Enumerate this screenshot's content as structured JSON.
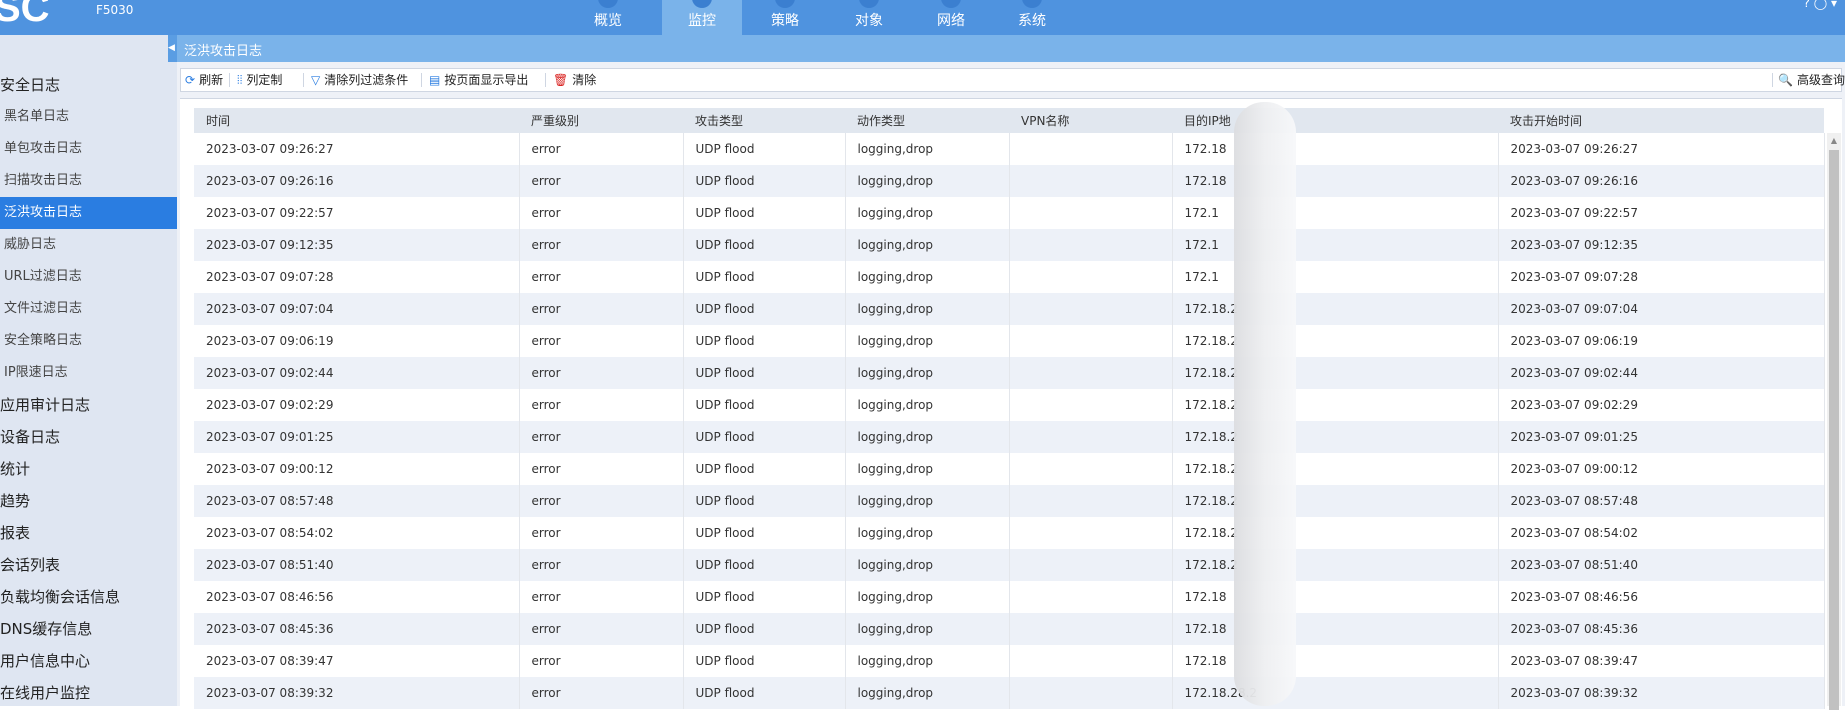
{
  "header": {
    "logo": "SC",
    "model": "F5030",
    "nav": [
      {
        "label": "概览"
      },
      {
        "label": "监控",
        "active": true
      },
      {
        "label": "策略"
      },
      {
        "label": "对象"
      },
      {
        "label": "网络"
      },
      {
        "label": "系统"
      }
    ]
  },
  "sidebar": {
    "items": [
      {
        "label": "安全日志",
        "level": 1
      },
      {
        "label": "黑名单日志",
        "level": 2
      },
      {
        "label": "单包攻击日志",
        "level": 2
      },
      {
        "label": "扫描攻击日志",
        "level": 2
      },
      {
        "label": "泛洪攻击日志",
        "level": 2,
        "selected": true
      },
      {
        "label": "威胁日志",
        "level": 2
      },
      {
        "label": "URL过滤日志",
        "level": 2
      },
      {
        "label": "文件过滤日志",
        "level": 2
      },
      {
        "label": "安全策略日志",
        "level": 2
      },
      {
        "label": "IP限速日志",
        "level": 2
      },
      {
        "label": "应用审计日志",
        "level": 1
      },
      {
        "label": "设备日志",
        "level": 1
      },
      {
        "label": "统计",
        "level": 1
      },
      {
        "label": "趋势",
        "level": 1
      },
      {
        "label": "报表",
        "level": 1
      },
      {
        "label": "会话列表",
        "level": 1
      },
      {
        "label": "负载均衡会话信息",
        "level": 1
      },
      {
        "label": "DNS缓存信息",
        "level": 1
      },
      {
        "label": "用户信息中心",
        "level": 1
      },
      {
        "label": "在线用户监控",
        "level": 1
      }
    ]
  },
  "breadcrumb": "泛洪攻击日志",
  "toolbar": {
    "refresh": "刷新",
    "columns": "列定制",
    "clear_filter": "清除列过滤条件",
    "export": "按页面显示导出",
    "clear": "清除",
    "advanced": "高级查询"
  },
  "table": {
    "headers": [
      "时间",
      "严重级别",
      "攻击类型",
      "动作类型",
      "VPN名称",
      "目的IP地",
      "攻击开始时间"
    ],
    "rows": [
      [
        "2023-03-07 09:26:27",
        "error",
        "UDP flood",
        "logging,drop",
        "",
        "172.18",
        "2023-03-07 09:26:27"
      ],
      [
        "2023-03-07 09:26:16",
        "error",
        "UDP flood",
        "logging,drop",
        "",
        "172.18",
        "2023-03-07 09:26:16"
      ],
      [
        "2023-03-07 09:22:57",
        "error",
        "UDP flood",
        "logging,drop",
        "",
        "172.1",
        "2023-03-07 09:22:57"
      ],
      [
        "2023-03-07 09:12:35",
        "error",
        "UDP flood",
        "logging,drop",
        "",
        "172.1",
        "2023-03-07 09:12:35"
      ],
      [
        "2023-03-07 09:07:28",
        "error",
        "UDP flood",
        "logging,drop",
        "",
        "172.1",
        "2023-03-07 09:07:28"
      ],
      [
        "2023-03-07 09:07:04",
        "error",
        "UDP flood",
        "logging,drop",
        "",
        "172.18.2",
        "2023-03-07 09:07:04"
      ],
      [
        "2023-03-07 09:06:19",
        "error",
        "UDP flood",
        "logging,drop",
        "",
        "172.18.2",
        "2023-03-07 09:06:19"
      ],
      [
        "2023-03-07 09:02:44",
        "error",
        "UDP flood",
        "logging,drop",
        "",
        "172.18.2",
        "2023-03-07 09:02:44"
      ],
      [
        "2023-03-07 09:02:29",
        "error",
        "UDP flood",
        "logging,drop",
        "",
        "172.18.2",
        "2023-03-07 09:02:29"
      ],
      [
        "2023-03-07 09:01:25",
        "error",
        "UDP flood",
        "logging,drop",
        "",
        "172.18.2",
        "2023-03-07 09:01:25"
      ],
      [
        "2023-03-07 09:00:12",
        "error",
        "UDP flood",
        "logging,drop",
        "",
        "172.18.2",
        "2023-03-07 09:00:12"
      ],
      [
        "2023-03-07 08:57:48",
        "error",
        "UDP flood",
        "logging,drop",
        "",
        "172.18.2",
        "2023-03-07 08:57:48"
      ],
      [
        "2023-03-07 08:54:02",
        "error",
        "UDP flood",
        "logging,drop",
        "",
        "172.18.2",
        "2023-03-07 08:54:02"
      ],
      [
        "2023-03-07 08:51:40",
        "error",
        "UDP flood",
        "logging,drop",
        "",
        "172.18.2",
        "2023-03-07 08:51:40"
      ],
      [
        "2023-03-07 08:46:56",
        "error",
        "UDP flood",
        "logging,drop",
        "",
        "172.18",
        "2023-03-07 08:46:56"
      ],
      [
        "2023-03-07 08:45:36",
        "error",
        "UDP flood",
        "logging,drop",
        "",
        "172.18",
        "2023-03-07 08:45:36"
      ],
      [
        "2023-03-07 08:39:47",
        "error",
        "UDP flood",
        "logging,drop",
        "",
        "172.18",
        "2023-03-07 08:39:47"
      ],
      [
        "2023-03-07 08:39:32",
        "error",
        "UDP flood",
        "logging,drop",
        "",
        "172.18.28.2",
        "2023-03-07 08:39:32"
      ]
    ]
  }
}
